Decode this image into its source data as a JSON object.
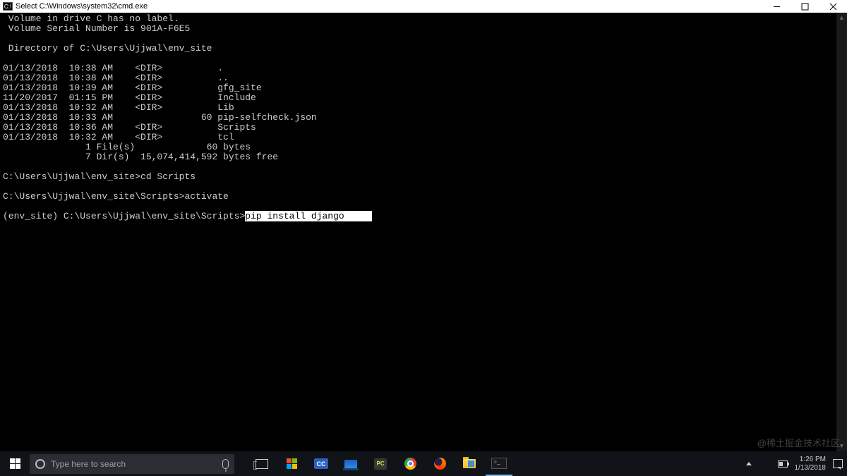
{
  "titlebar": {
    "title": "Select C:\\Windows\\system32\\cmd.exe",
    "icon_label": "C:\\"
  },
  "terminal": {
    "volume_label": " Volume in drive C has no label.",
    "volume_serial": " Volume Serial Number is 901A-F6E5",
    "directory_of": " Directory of C:\\Users\\Ujjwal\\env_site",
    "listing": [
      "01/13/2018  10:38 AM    <DIR>          .",
      "01/13/2018  10:38 AM    <DIR>          ..",
      "01/13/2018  10:39 AM    <DIR>          gfg_site",
      "11/20/2017  01:15 PM    <DIR>          Include",
      "01/13/2018  10:32 AM    <DIR>          Lib",
      "01/13/2018  10:33 AM                60 pip-selfcheck.json",
      "01/13/2018  10:36 AM    <DIR>          Scripts",
      "01/13/2018  10:32 AM    <DIR>          tcl",
      "               1 File(s)             60 bytes",
      "               7 Dir(s)  15,074,414,592 bytes free"
    ],
    "prompt1": "C:\\Users\\Ujjwal\\env_site>cd Scripts",
    "prompt2": "C:\\Users\\Ujjwal\\env_site\\Scripts>activate",
    "prompt3_prefix": "(env_site) C:\\Users\\Ujjwal\\env_site\\Scripts>",
    "prompt3_command": "pip install django ",
    "cursor_pad": "    "
  },
  "watermark": "@稀土掘金技术社区",
  "taskbar": {
    "search_placeholder": "Type here to search",
    "time": "1:26 PM",
    "date": "1/13/2018",
    "cc_label": "CC",
    "pc_label": "PC"
  }
}
